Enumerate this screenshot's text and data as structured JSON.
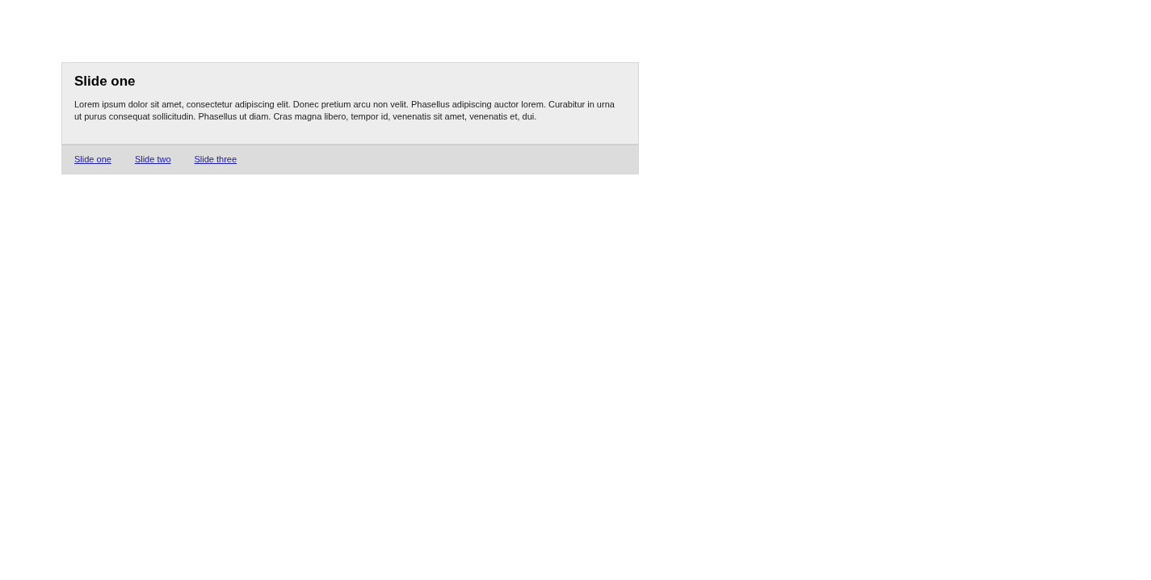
{
  "slide": {
    "title": "Slide one",
    "body": "Lorem ipsum dolor sit amet, consectetur adipiscing elit. Donec pretium arcu non velit. Phasellus adipiscing auctor lorem. Curabitur in urna ut purus consequat sollicitudin. Phasellus ut diam. Cras magna libero, tempor id, venenatis sit amet, venenatis et, dui."
  },
  "nav_links": [
    {
      "label": "Slide one"
    },
    {
      "label": "Slide two"
    },
    {
      "label": "Slide three"
    }
  ]
}
